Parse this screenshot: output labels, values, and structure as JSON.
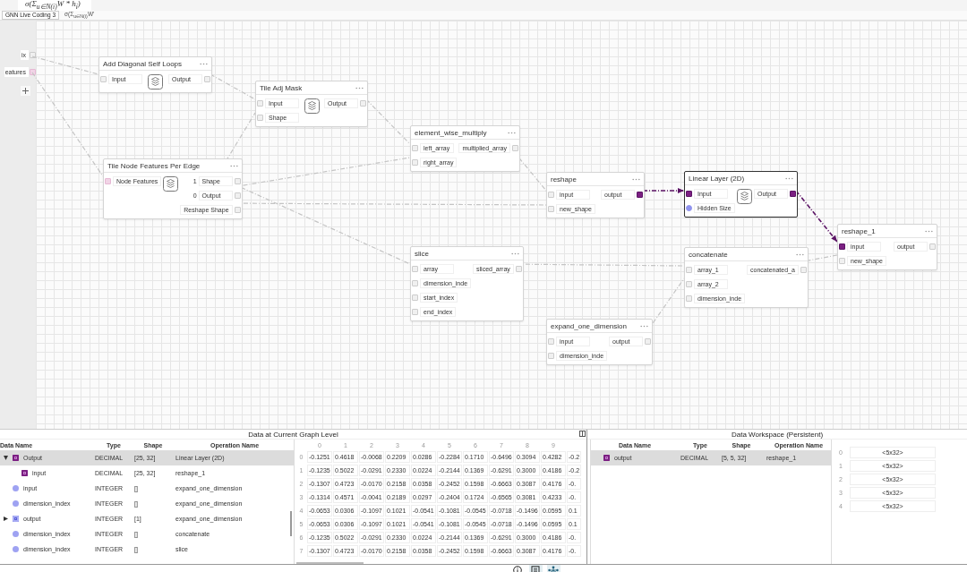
{
  "formula": "σ(Σ$_{u∈N(i)}$W * h$_{i}$)",
  "tabs": [
    {
      "label": "GNN Live Coding 3",
      "selected": true
    },
    {
      "label": "σ(Σ$_{u∈N(i)}$W'",
      "selected": false
    }
  ],
  "graph_inputs": [
    {
      "label": "ix",
      "kind": "plain"
    },
    {
      "label": "eatures",
      "kind": "feature"
    }
  ],
  "nodes": [
    {
      "title": "Add Diagonal Self Loops",
      "selected": false,
      "has_icon": true,
      "inputs": [
        {
          "label": "Input",
          "kind": "plain"
        }
      ],
      "outputs": [
        {
          "label": "Output",
          "kind": "plain"
        }
      ]
    },
    {
      "title": "Tile Adj Mask",
      "selected": false,
      "has_icon": true,
      "inputs": [
        {
          "label": "Input",
          "kind": "plain"
        },
        {
          "label": "Shape",
          "kind": "plain"
        }
      ],
      "outputs": [
        {
          "label": "Output",
          "kind": "plain"
        }
      ]
    },
    {
      "title": "Tile Node Features Per Edge",
      "selected": false,
      "has_icon": true,
      "inputs": [
        {
          "label": "Node Features",
          "kind": "feature"
        }
      ],
      "outputs": [
        {
          "prefix": "1",
          "label": "Shape",
          "kind": "plain"
        },
        {
          "prefix": "0",
          "label": "Output",
          "kind": "plain"
        },
        {
          "label": "Reshape Shape",
          "kind": "plain"
        }
      ]
    },
    {
      "title": "element_wise_multiply",
      "selected": false,
      "has_icon": false,
      "inputs": [
        {
          "label": "left_array",
          "kind": "plain"
        },
        {
          "label": "right_array",
          "kind": "plain"
        }
      ],
      "outputs": [
        {
          "label": "multiplied_array",
          "kind": "plain"
        }
      ]
    },
    {
      "title": "reshape",
      "selected": false,
      "has_icon": false,
      "inputs": [
        {
          "label": "input",
          "kind": "plain"
        },
        {
          "label": "new_shape",
          "kind": "plain"
        }
      ],
      "outputs": [
        {
          "label": "output",
          "kind": "active"
        }
      ]
    },
    {
      "title": "Linear Layer (2D)",
      "selected": true,
      "has_icon": true,
      "inputs": [
        {
          "label": "Input",
          "kind": "active"
        },
        {
          "label": "Hidden Size",
          "kind": "param"
        }
      ],
      "outputs": [
        {
          "label": "Output",
          "kind": "active"
        }
      ]
    },
    {
      "title": "reshape_1",
      "selected": false,
      "has_icon": false,
      "inputs": [
        {
          "label": "input",
          "kind": "active"
        },
        {
          "label": "new_shape",
          "kind": "plain"
        }
      ],
      "outputs": [
        {
          "label": "output",
          "kind": "plain"
        }
      ]
    },
    {
      "title": "slice",
      "selected": false,
      "has_icon": false,
      "inputs": [
        {
          "label": "array",
          "kind": "plain"
        },
        {
          "label": "dimension_inde",
          "kind": "plain"
        },
        {
          "label": "start_index",
          "kind": "plain"
        },
        {
          "label": "end_index",
          "kind": "plain"
        }
      ],
      "outputs": [
        {
          "label": "sliced_array",
          "kind": "plain"
        }
      ]
    },
    {
      "title": "concatenate",
      "selected": false,
      "has_icon": false,
      "inputs": [
        {
          "label": "array_1",
          "kind": "plain"
        },
        {
          "label": "array_2",
          "kind": "plain"
        },
        {
          "label": "dimension_inde",
          "kind": "plain"
        }
      ],
      "outputs": [
        {
          "label": "concatenated_a",
          "kind": "plain"
        }
      ]
    },
    {
      "title": "expand_one_dimension",
      "selected": false,
      "has_icon": false,
      "inputs": [
        {
          "label": "input",
          "kind": "plain"
        },
        {
          "label": "dimension_inde",
          "kind": "plain"
        }
      ],
      "outputs": [
        {
          "label": "output",
          "kind": "plain"
        }
      ]
    }
  ],
  "edges": [
    {
      "highlighted": false
    },
    {
      "highlighted": false
    },
    {
      "highlighted": false
    },
    {
      "highlighted": false
    },
    {
      "highlighted": false
    },
    {
      "highlighted": false
    },
    {
      "highlighted": false
    },
    {
      "highlighted": false
    },
    {
      "highlighted": false
    },
    {
      "highlighted": true
    },
    {
      "highlighted": true
    },
    {
      "highlighted": false
    },
    {
      "highlighted": false
    },
    {
      "highlighted": false
    }
  ],
  "current_panel": {
    "title": "Data at Current Graph Level",
    "columns": [
      "Data Name",
      "Type",
      "Shape",
      "Operation Name"
    ],
    "rows": [
      {
        "name": "Output",
        "kind": "output",
        "type": "DECIMAL",
        "shape": "[25, 32]",
        "operation": "Linear Layer (2D)",
        "selected": true,
        "expanded": true,
        "children": [
          {
            "name": "input",
            "kind": "output",
            "type": "DECIMAL",
            "shape": "[25, 32]",
            "operation": "reshape_1",
            "selected": false
          }
        ]
      },
      {
        "name": "input",
        "kind": "param",
        "type": "INTEGER",
        "shape": "[]",
        "operation": "expand_one_dimension",
        "selected": false
      },
      {
        "name": "dimension_index",
        "kind": "param",
        "type": "INTEGER",
        "shape": "[]",
        "operation": "expand_one_dimension",
        "selected": false
      },
      {
        "name": "output",
        "kind": "tensor",
        "type": "INTEGER",
        "shape": "[1]",
        "operation": "expand_one_dimension",
        "selected": false,
        "expanded": false
      },
      {
        "name": "dimension_index",
        "kind": "param",
        "type": "INTEGER",
        "shape": "[]",
        "operation": "concatenate",
        "selected": false
      },
      {
        "name": "dimension_index",
        "kind": "param",
        "type": "INTEGER",
        "shape": "[]",
        "operation": "slice",
        "selected": false
      }
    ],
    "matrix": {
      "columns": [
        "0",
        "1",
        "2",
        "3",
        "4",
        "5",
        "6",
        "7",
        "8",
        "9"
      ],
      "rows": [
        {
          "index": "0",
          "values": [
            "-0.1251",
            "0.4618",
            "-0.0068",
            "0.2209",
            "0.0286",
            "-0.2284",
            "0.1710",
            "-0.6496",
            "0.3094",
            "0.4282",
            "-0.2"
          ]
        },
        {
          "index": "1",
          "values": [
            "-0.1235",
            "0.5022",
            "-0.0291",
            "0.2330",
            "0.0224",
            "-0.2144",
            "0.1369",
            "-0.6291",
            "0.3000",
            "0.4186",
            "-0.2"
          ]
        },
        {
          "index": "2",
          "values": [
            "-0.1307",
            "0.4723",
            "-0.0170",
            "0.2158",
            "0.0358",
            "-0.2452",
            "0.1598",
            "-0.6663",
            "0.3087",
            "0.4176",
            "-0."
          ]
        },
        {
          "index": "3",
          "values": [
            "-0.1314",
            "0.4571",
            "-0.0041",
            "0.2189",
            "0.0297",
            "-0.2404",
            "0.1724",
            "-0.6565",
            "0.3081",
            "0.4233",
            "-0."
          ]
        },
        {
          "index": "4",
          "values": [
            "-0.0653",
            "0.0306",
            "-0.1097",
            "0.1021",
            "-0.0541",
            "-0.1081",
            "-0.0545",
            "-0.0718",
            "-0.1496",
            "0.0595",
            "0.1"
          ]
        },
        {
          "index": "5",
          "values": [
            "-0.0653",
            "0.0306",
            "-0.1097",
            "0.1021",
            "-0.0541",
            "-0.1081",
            "-0.0545",
            "-0.0718",
            "-0.1496",
            "0.0595",
            "0.1"
          ]
        },
        {
          "index": "6",
          "values": [
            "-0.1235",
            "0.5022",
            "-0.0291",
            "0.2330",
            "0.0224",
            "-0.2144",
            "0.1369",
            "-0.6291",
            "0.3000",
            "0.4186",
            "-0."
          ]
        },
        {
          "index": "7",
          "values": [
            "-0.1307",
            "0.4723",
            "-0.0170",
            "0.2158",
            "0.0358",
            "-0.2452",
            "0.1598",
            "-0.6663",
            "0.3087",
            "0.4176",
            "-0."
          ]
        }
      ]
    }
  },
  "workspace": {
    "title": "Data Workspace (Persistent)",
    "columns": [
      "Data Name",
      "Type",
      "Shape",
      "Operation Name"
    ],
    "rows": [
      {
        "name": "output",
        "kind": "output",
        "type": "DECIMAL",
        "shape": "[5, 5, 32]",
        "operation": "reshape_1",
        "selected": true
      }
    ],
    "items": [
      {
        "index": "0",
        "value": "<5x32>"
      },
      {
        "index": "1",
        "value": "<5x32>"
      },
      {
        "index": "2",
        "value": "<5x32>"
      },
      {
        "index": "3",
        "value": "<5x32>"
      },
      {
        "index": "4",
        "value": "<5x32>"
      }
    ]
  },
  "bottom_toolbar": [
    {
      "kind": "info",
      "selected": false
    },
    {
      "kind": "list",
      "selected": true
    },
    {
      "kind": "network",
      "selected": true
    }
  ]
}
